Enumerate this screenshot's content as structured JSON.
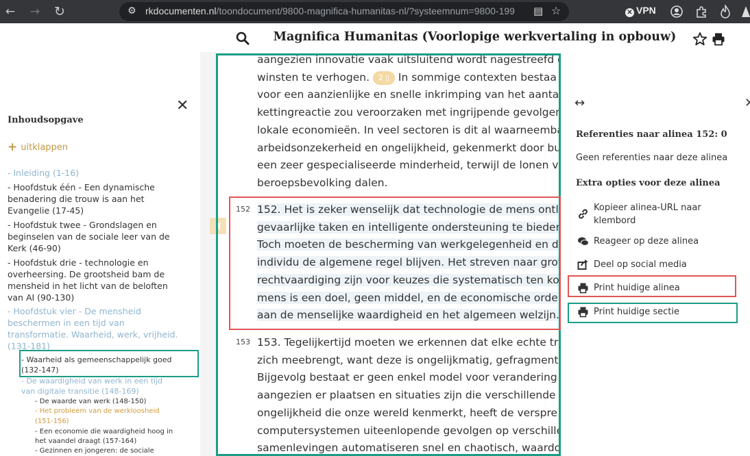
{
  "browser": {
    "back": "←",
    "forward": "→",
    "reload": "↻",
    "url_domain": "rkdocumenten.nl",
    "url_path": "/toondocument/9800-magnifica-humanitas-nl/?systeemnum=9800-199",
    "vpn_label": "VPN"
  },
  "header": {
    "title": "Magnifica Humanitas (Voorlopige werkvertaling in opbouw)"
  },
  "sidebar": {
    "close": "✕",
    "heading": "Inhoudsopgave",
    "expand_label": "uitklappen",
    "items": [
      {
        "text": "- Inleiding (1-16)"
      },
      {
        "text": "- Hoofdstuk één - Een dynamische"
      },
      {
        "text": "benadering die trouw is aan het"
      },
      {
        "text": "Evangelie (17-45)"
      },
      {
        "text": "- Hoofdstuk twee - Grondslagen en"
      },
      {
        "text": "beginselen van de sociale leer van de"
      },
      {
        "text": "Kerk (46-90)"
      },
      {
        "text": "- Hoofdstuk drie - technologie en"
      },
      {
        "text": "overheersing. De grootsheid bam de"
      },
      {
        "text": "mensheid in het licht van de beloften"
      },
      {
        "text": "van AI (90-130)"
      },
      {
        "text": "- Hoofdstuk vier - De mensheid"
      },
      {
        "text": "beschermen in een tijd van"
      },
      {
        "text": "transformatie. Waarheid, werk, vrijheid."
      },
      {
        "text": "(131-181)"
      },
      {
        "text": "- Waarheid als gemeenschappelijk goed"
      },
      {
        "text": "(132-147)"
      },
      {
        "text": "- De waardigheid van werk in een tijd"
      },
      {
        "text": "van digitale transitie (148-169)"
      },
      {
        "text": "- De waarde van werk (148-150)"
      },
      {
        "text": "- Het probleem van de werkloosheid"
      },
      {
        "text": "(151-156)"
      },
      {
        "text": "- Een economie die waardigheid hoog in"
      },
      {
        "text": "het vaandel draagt (157-164)"
      },
      {
        "text": "- Gezinnen en jongeren: de sociale"
      }
    ]
  },
  "main": {
    "prev_lines": [
      "aangezien innovatie vaak uitsluitend wordt nagestreefd o",
      "winsten te verhogen.",
      " In sommige contexten bestaa",
      "voor een aanzienlijke en snelle inkrimping van het aanta",
      "kettingreactie zou veroorzaken met ingrijpende gevolgen",
      "lokale economieën. In veel sectoren is dit al waarneemba",
      "arbeidsonzekerheid en ongelijkheid, gekenmerkt door bu",
      "een zeer gespecialiseerde minderheid, terwijl de lonen v",
      "beroepsbevolking dalen."
    ],
    "badge": "2",
    "p152": {
      "number": "152",
      "lines": [
        "152. Het is zeker wenselijk dat technologie de mens ontl",
        "gevaarlijke taken en intelligente ondersteuning te bieden",
        "Toch moeten de bescherming van werkgelegenheid en d",
        "individu de algemene regel blijven. Het streven naar grot",
        "rechtvaardiging zijn voor keuzes die systematisch ten kos",
        "mens is een doel, geen middel, en de economische orde",
        "aan de menselijke waardigheid en het algemeen welzijn."
      ]
    },
    "p153": {
      "number": "153",
      "lines": [
        "153. Tegelijkertijd moeten we erkennen dat elke echte tra",
        "zich meebrengt, want deze is ongelijkmatig, gefragmente",
        "Bijgevolg bestaat er geen enkel model voor verandering o",
        "aangezien er plaatsen en situaties zijn die verschillende n",
        "ongelijkheid die onze wereld kenmerkt, heeft de verspre",
        "computersystemen uiteenlopende gevolgen op verschille",
        "samenlevingen automatiseren snel en chaotisch, waardo"
      ]
    }
  },
  "right_panel": {
    "resize": "↔",
    "close": "✕",
    "references_heading": "Referenties naar alinea 152: 0",
    "no_references": "Geen referenties naar deze alinea",
    "extra_heading": "Extra opties voor deze alinea",
    "options": {
      "copy_line1": "Kopieer alinea-URL naar",
      "copy_line2": "klembord",
      "comment": "Reageer op deze alinea",
      "share": "Deel op social media",
      "print_paragraph": "Print huidige alinea",
      "print_section": "Print huidige sectie"
    }
  },
  "colors": {
    "accent_gold": "#c09a45",
    "toc_blue": "#8fb5cf",
    "toc_active": "#d19a3b",
    "annotation_green": "#1b9c85",
    "annotation_red": "#e05555"
  }
}
